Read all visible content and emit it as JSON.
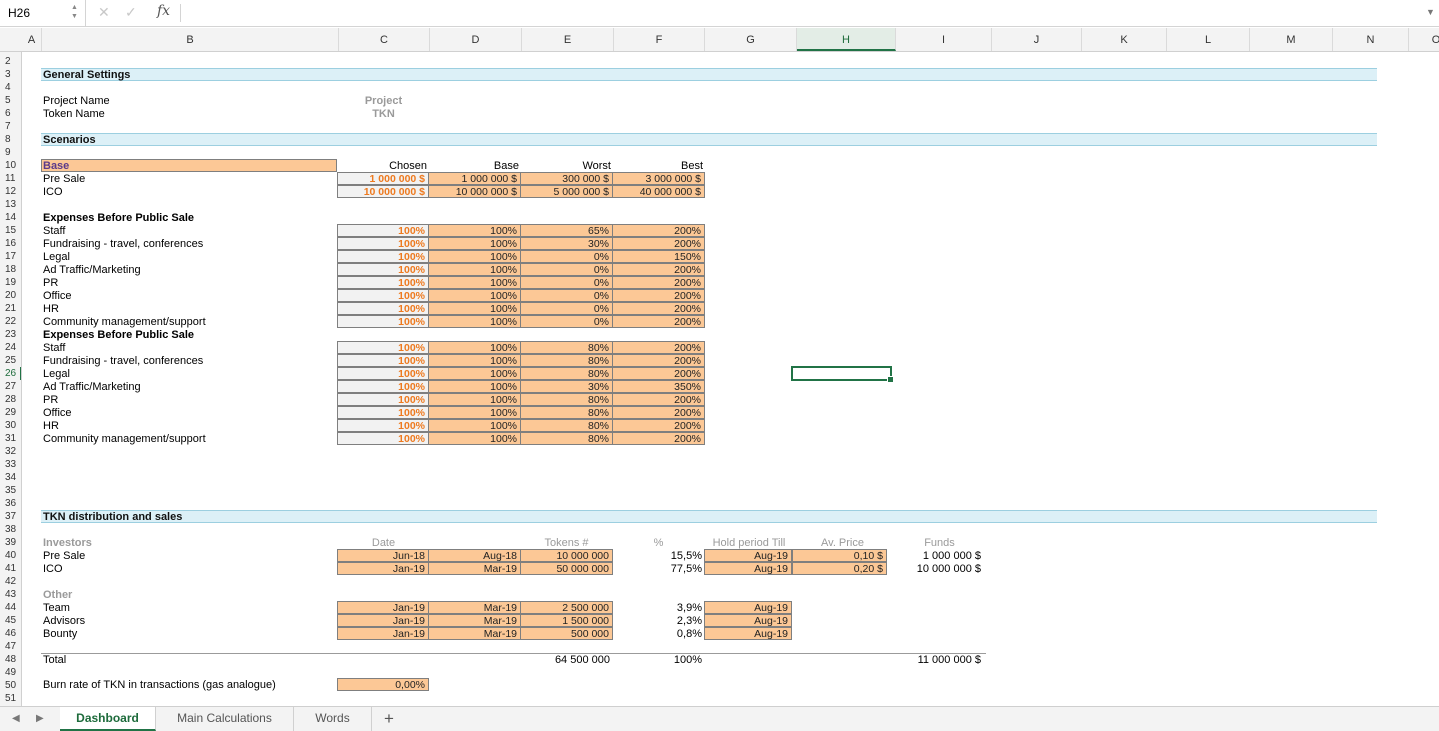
{
  "formula_bar": {
    "name_box": "H26",
    "fx_label": "fx",
    "formula": ""
  },
  "columns": [
    "A",
    "B",
    "C",
    "D",
    "E",
    "F",
    "G",
    "H",
    "I",
    "J",
    "K",
    "L",
    "M",
    "N",
    "O"
  ],
  "selected_column": "H",
  "rows_start": 2,
  "rows_end": 51,
  "selected_row": 26,
  "sheet": {
    "general": {
      "title": "General Settings",
      "project_name_label": "Project Name",
      "project_name_value": "Project",
      "token_name_label": "Token Name",
      "token_name_value": "TKN"
    },
    "scenarios": {
      "title": "Scenarios",
      "base_label": "Base",
      "headers": [
        "Chosen",
        "Base",
        "Worst",
        "Best"
      ],
      "rows": [
        {
          "label": "Pre Sale",
          "values": [
            "1 000 000 $",
            "1 000 000 $",
            "300 000 $",
            "3 000 000 $"
          ]
        },
        {
          "label": "ICO",
          "values": [
            "10 000 000 $",
            "10 000 000 $",
            "5 000 000 $",
            "40 000 000 $"
          ]
        }
      ]
    },
    "expenses_1": {
      "title": "Expenses Before Public Sale",
      "rows": [
        {
          "label": "Staff",
          "values": [
            "100%",
            "100%",
            "65%",
            "200%"
          ]
        },
        {
          "label": "Fundraising - travel, conferences",
          "values": [
            "100%",
            "100%",
            "30%",
            "200%"
          ]
        },
        {
          "label": "Legal",
          "values": [
            "100%",
            "100%",
            "0%",
            "150%"
          ]
        },
        {
          "label": "Ad Traffic/Marketing",
          "values": [
            "100%",
            "100%",
            "0%",
            "200%"
          ]
        },
        {
          "label": "PR",
          "values": [
            "100%",
            "100%",
            "0%",
            "200%"
          ]
        },
        {
          "label": "Office",
          "values": [
            "100%",
            "100%",
            "0%",
            "200%"
          ]
        },
        {
          "label": "HR",
          "values": [
            "100%",
            "100%",
            "0%",
            "200%"
          ]
        },
        {
          "label": "Community management/support",
          "values": [
            "100%",
            "100%",
            "0%",
            "200%"
          ]
        }
      ]
    },
    "expenses_2": {
      "title": "Expenses Before Public Sale",
      "rows": [
        {
          "label": "Staff",
          "values": [
            "100%",
            "100%",
            "80%",
            "200%"
          ]
        },
        {
          "label": "Fundraising - travel, conferences",
          "values": [
            "100%",
            "100%",
            "80%",
            "200%"
          ]
        },
        {
          "label": "Legal",
          "values": [
            "100%",
            "100%",
            "80%",
            "200%"
          ]
        },
        {
          "label": "Ad Traffic/Marketing",
          "values": [
            "100%",
            "100%",
            "30%",
            "350%"
          ]
        },
        {
          "label": "PR",
          "values": [
            "100%",
            "100%",
            "80%",
            "200%"
          ]
        },
        {
          "label": "Office",
          "values": [
            "100%",
            "100%",
            "80%",
            "200%"
          ]
        },
        {
          "label": "HR",
          "values": [
            "100%",
            "100%",
            "80%",
            "200%"
          ]
        },
        {
          "label": "Community management/support",
          "values": [
            "100%",
            "100%",
            "80%",
            "200%"
          ]
        }
      ]
    },
    "distribution": {
      "title": "TKN distribution and sales",
      "investors_label": "Investors",
      "headers": {
        "date": "Date",
        "tokens": "Tokens #",
        "pct": "%",
        "hold": "Hold period Till",
        "price": "Av. Price",
        "funds": "Funds"
      },
      "investors": [
        {
          "label": "Pre Sale",
          "date": "Jun-18",
          "end": "Aug-18",
          "tokens": "10 000 000",
          "pct": "15,5%",
          "hold": "Aug-19",
          "price": "0,10 $",
          "funds": "1 000 000 $"
        },
        {
          "label": "ICO",
          "date": "Jan-19",
          "end": "Mar-19",
          "tokens": "50 000 000",
          "pct": "77,5%",
          "hold": "Aug-19",
          "price": "0,20 $",
          "funds": "10 000 000 $"
        }
      ],
      "other_label": "Other",
      "other": [
        {
          "label": "Team",
          "date": "Jan-19",
          "end": "Mar-19",
          "tokens": "2 500 000",
          "pct": "3,9%",
          "hold": "Aug-19"
        },
        {
          "label": "Advisors",
          "date": "Jan-19",
          "end": "Mar-19",
          "tokens": "1 500 000",
          "pct": "2,3%",
          "hold": "Aug-19"
        },
        {
          "label": "Bounty",
          "date": "Jan-19",
          "end": "Mar-19",
          "tokens": "500 000",
          "pct": "0,8%",
          "hold": "Aug-19"
        }
      ],
      "total_label": "Total",
      "total_tokens": "64 500 000",
      "total_pct": "100%",
      "total_funds": "11 000 000 $",
      "burn_label": "Burn rate of TKN in transactions (gas analogue)",
      "burn_value": "0,00%"
    }
  },
  "tabs": {
    "items": [
      "Dashboard",
      "Main Calculations",
      "Words"
    ],
    "active": "Dashboard",
    "add_label": "+"
  },
  "colors": {
    "accent": "#217346",
    "input_fill": "#fcc896",
    "section_band": "#dcf0f7",
    "chosen_text": "#ee7a1f"
  }
}
